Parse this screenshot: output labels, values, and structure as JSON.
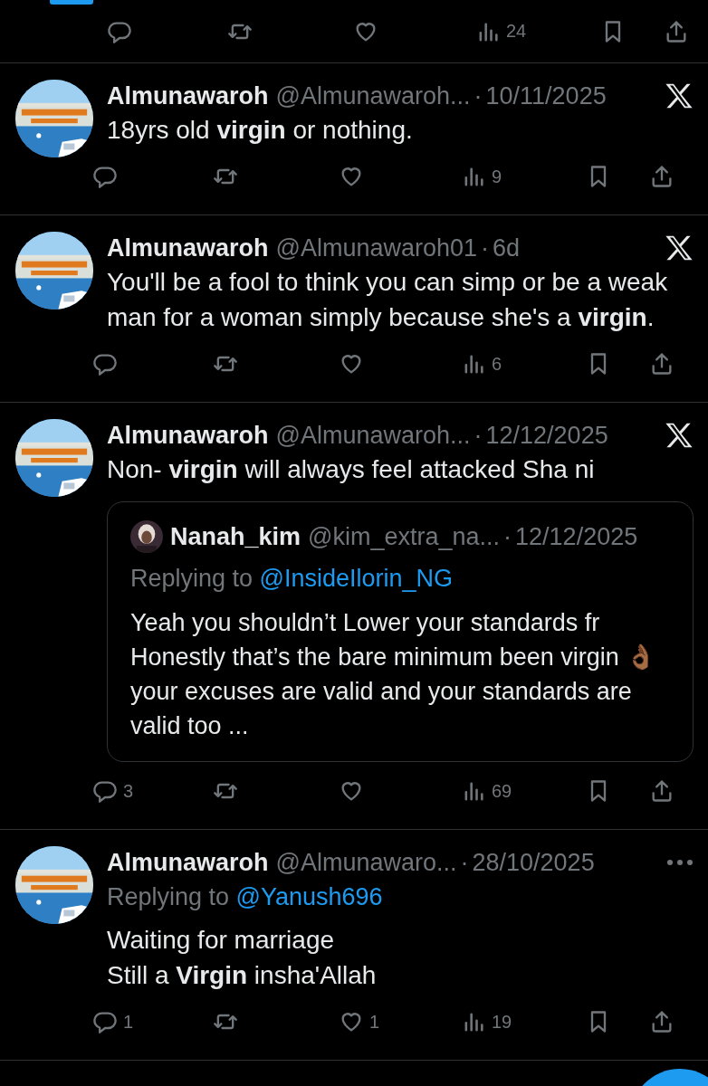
{
  "top_actions": {
    "views": "24"
  },
  "tweets": [
    {
      "name": "Almunawaroh",
      "handle": "@Almunawaroh...",
      "separator": "·",
      "date": "10/11/2025",
      "menu": {
        "kind": "x-logo"
      },
      "text_lines": [
        "18yrs old **virgin** or nothing."
      ],
      "actions": {
        "views": "9"
      }
    },
    {
      "name": "Almunawaroh",
      "handle": "@Almunawaroh01",
      "separator": "·",
      "date": "6d",
      "menu": {
        "kind": "x-logo"
      },
      "text_lines": [
        "You'll be a fool to think you can simp or be a weak man for a woman simply because she's a **virgin**."
      ],
      "actions": {
        "views": "6"
      }
    },
    {
      "name": "Almunawaroh",
      "handle": "@Almunawaroh...",
      "separator": "·",
      "date": "12/12/2025",
      "menu": {
        "kind": "x-logo"
      },
      "text_lines": [
        "Non- **virgin** will always feel attacked Sha ni"
      ],
      "quote": {
        "name": "Nanah_kim",
        "handle": "@kim_extra_na...",
        "separator": "·",
        "date": "12/12/2025",
        "replying_label": "Replying to",
        "replying_to": "@InsideIlorin_NG",
        "text": "Yeah you shouldn’t Lower your standards fr Honestly that’s the bare minimum been virgin 👌🏾 your excuses are valid and your standards are valid too ..."
      },
      "actions": {
        "replies": "3",
        "views": "69"
      }
    },
    {
      "name": "Almunawaroh",
      "handle": "@Almunawaro...",
      "separator": "·",
      "date": "28/10/2025",
      "menu": {
        "kind": "more"
      },
      "replying_label": "Replying to",
      "replying_to": "@Yanush696",
      "text_lines": [
        "Waiting for marriage",
        "Still a **Virgin** insha'Allah"
      ],
      "actions": {
        "replies": "1",
        "likes": "1",
        "views": "19"
      }
    }
  ]
}
